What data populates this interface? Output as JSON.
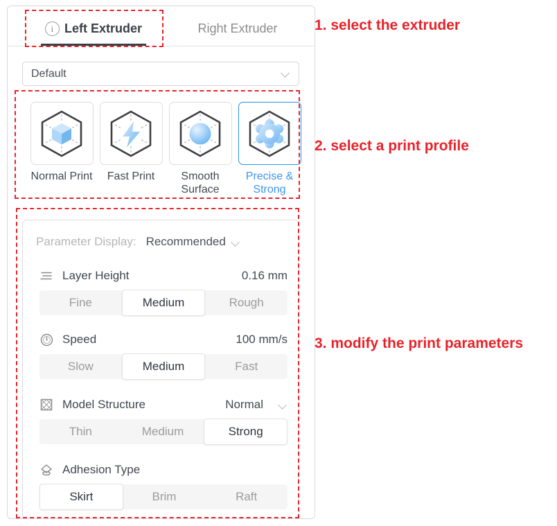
{
  "tabs": [
    {
      "id": "left-extruder",
      "label": "Left Extruder",
      "icon": "info-icon",
      "active": true
    },
    {
      "id": "right-extruder",
      "label": "Right Extruder",
      "icon": "",
      "active": false
    }
  ],
  "profile_select": {
    "value": "Default",
    "icon": "chevron-down-icon"
  },
  "profiles": [
    {
      "id": "normal-print",
      "label": "Normal Print",
      "icon": "cube-icon",
      "selected": false
    },
    {
      "id": "fast-print",
      "label": "Fast Print",
      "icon": "lightning-icon",
      "selected": false
    },
    {
      "id": "smooth-surface",
      "label": "Smooth Surface",
      "icon": "sphere-icon",
      "selected": false
    },
    {
      "id": "precise-strong",
      "label": "Precise & Strong",
      "icon": "gear-icon",
      "selected": true
    }
  ],
  "parameters": {
    "display": {
      "label": "Parameter Display:",
      "value": "Recommended",
      "icon": "chevron-down-icon"
    },
    "rows": [
      {
        "id": "layer-height",
        "icon": "layers-icon",
        "title": "Layer Height",
        "value": "0.16 mm",
        "options": [
          "Fine",
          "Medium",
          "Rough"
        ],
        "selected": "Medium"
      },
      {
        "id": "speed",
        "icon": "speedometer-icon",
        "title": "Speed",
        "value": "100 mm/s",
        "options": [
          "Slow",
          "Medium",
          "Fast"
        ],
        "selected": "Medium"
      },
      {
        "id": "model-structure",
        "icon": "grid-mesh-icon",
        "title": "Model Structure",
        "dropdown_value": "Normal",
        "dropdown_icon": "chevron-down-icon",
        "options": [
          "Thin",
          "Medium",
          "Strong"
        ],
        "selected": "Strong"
      },
      {
        "id": "adhesion-type",
        "icon": "adhesion-icon",
        "title": "Adhesion Type",
        "options": [
          "Skirt",
          "Brim",
          "Raft"
        ],
        "selected": "Skirt"
      }
    ]
  },
  "annotations": [
    {
      "id": "note-1",
      "text": "1. select the extruder"
    },
    {
      "id": "note-2",
      "text": "2. select a print profile"
    },
    {
      "id": "note-3",
      "text": "3. modify the print parameters"
    }
  ],
  "colors": {
    "accent": "#3a94ef",
    "annotation": "#e8222a",
    "text": "#414751",
    "muted": "#9b9b9b"
  }
}
